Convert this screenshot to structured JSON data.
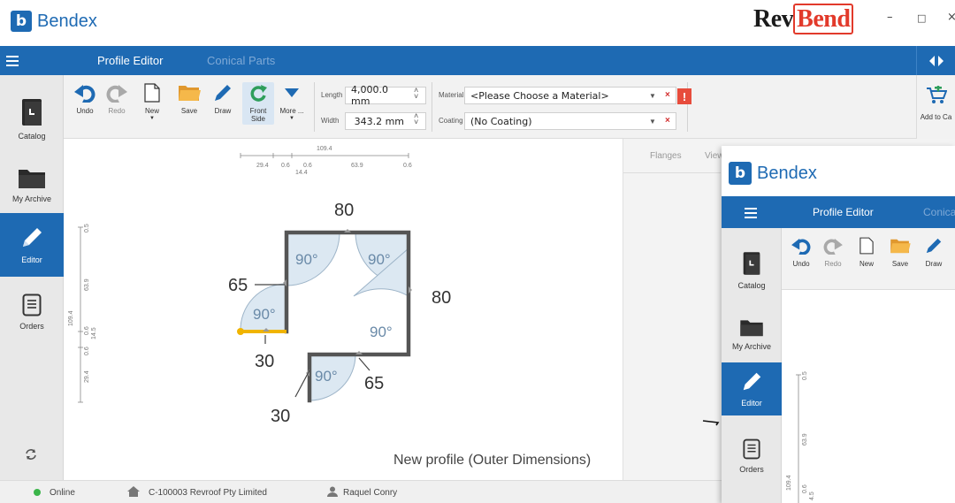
{
  "app": {
    "logo_letter": "b",
    "logo_text": "Bendex",
    "brand_prefix": "Rev",
    "brand_suffix": "Bend"
  },
  "window_controls": {
    "minimize": "–",
    "maximize": "□",
    "close": "×"
  },
  "tabs": [
    {
      "label": "Profile Editor",
      "active": true
    },
    {
      "label": "Conical Parts",
      "active": false
    }
  ],
  "sidebar": {
    "items": [
      {
        "label": "Catalog",
        "icon": "catalog-book-icon",
        "active": false
      },
      {
        "label": "My Archive",
        "icon": "folder-icon",
        "active": false
      },
      {
        "label": "Editor",
        "icon": "pencil-icon",
        "active": true
      },
      {
        "label": "Orders",
        "icon": "orders-list-icon",
        "active": false
      }
    ],
    "bottom_icon": "sync-icon"
  },
  "toolbar": {
    "undo": "Undo",
    "redo": "Redo",
    "new": "New",
    "save": "Save",
    "draw": "Draw",
    "front_side_line1": "Front",
    "front_side_line2": "Side",
    "more": "More ...",
    "length_label": "Length",
    "length_value": "4,000.0 mm",
    "width_label": "Width",
    "width_value": "343.2 mm",
    "material_label": "Material",
    "material_value": "<Please Choose a Material>",
    "coating_label": "Coating",
    "coating_value": "(No Coating)",
    "warning": "!",
    "add_to_cart": "Add to Ca"
  },
  "panel": {
    "tab_flanges": "Flanges",
    "tab_view": "View"
  },
  "drawing": {
    "caption": "New profile (Outer Dimensions)",
    "horizontal_ruler": {
      "total": "109.4",
      "segments": [
        "29.4",
        "0.6",
        "14.4",
        "0.6",
        "63.9",
        "0.6"
      ]
    },
    "vertical_ruler": {
      "total": "109.4",
      "segments": [
        "0.5",
        "63.9",
        "0.6",
        "14.5",
        "0.6",
        "29.4"
      ]
    },
    "flange_lengths": [
      "80",
      "80",
      "65",
      "30",
      "65",
      "30"
    ],
    "angles": [
      "90°",
      "90°",
      "90°",
      "90°",
      "90°"
    ],
    "colors": {
      "profile": "#555555",
      "highlight": "#f0b400",
      "arc_fill": "#dce8f2",
      "arc_stroke": "#9db4c8",
      "angle_text": "#6a8aa8"
    }
  },
  "status": {
    "connection": "Online",
    "company": "C-100003 Revroof Pty Limited",
    "user": "Raquel Conry"
  },
  "overlay": {
    "logo_text": "Bendex",
    "tab_active": "Profile Editor",
    "tab_inactive": "Conica",
    "toolbar": {
      "undo": "Undo",
      "redo": "Redo",
      "new": "New",
      "save": "Save",
      "draw": "Draw"
    },
    "sidebar": [
      "Catalog",
      "My Archive",
      "Editor",
      "Orders"
    ],
    "ruler_labels": [
      "0.5",
      "63.9",
      "109.4",
      "0.6",
      "4.5"
    ]
  },
  "accent_color": "#1e6ab3"
}
